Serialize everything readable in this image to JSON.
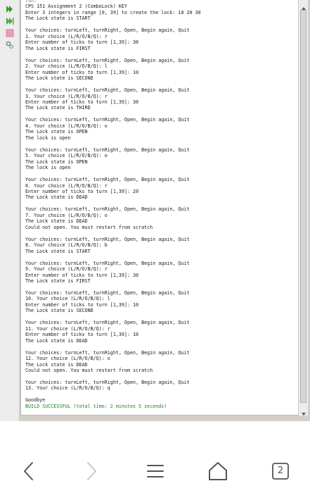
{
  "console": {
    "lines": [
      {
        "text": "run:",
        "style": "info"
      },
      {
        "text": "CPS 151 Assignment 2 (ComboLock) KEY"
      },
      {
        "text": "Enter 3 integers in range [0, 39] to create the lock: 10 20 30"
      },
      {
        "text": "The Lock state is START"
      },
      {
        "text": ""
      },
      {
        "text": "Your choices: turnLeft, turnRight, Open, Begin again, Quit"
      },
      {
        "text": "1. Your choice (L/R/O/B/Q): r"
      },
      {
        "text": "Enter number of ticks to turn [1,39]: 30"
      },
      {
        "text": "The Lock state is FIRST"
      },
      {
        "text": ""
      },
      {
        "text": "Your choices: turnLeft, turnRight, Open, Begin again, Quit"
      },
      {
        "text": "2. Your choice (L/R/O/B/Q): l"
      },
      {
        "text": "Enter number of ticks to turn [1,39]: 10"
      },
      {
        "text": "The Lock state is SECOND"
      },
      {
        "text": ""
      },
      {
        "text": "Your choices: turnLeft, turnRight, Open, Begin again, Quit"
      },
      {
        "text": "3. Your choice (L/R/O/B/Q): r"
      },
      {
        "text": "Enter number of ticks to turn [1,39]: 30"
      },
      {
        "text": "The Lock state is THIRD"
      },
      {
        "text": ""
      },
      {
        "text": "Your choices: turnLeft, turnRight, Open, Begin again, Quit"
      },
      {
        "text": "4. Your choice (L/R/O/B/Q): o"
      },
      {
        "text": "The Lock state is OPEN"
      },
      {
        "text": "The lock is open"
      },
      {
        "text": ""
      },
      {
        "text": "Your choices: turnLeft, turnRight, Open, Begin again, Quit"
      },
      {
        "text": "5. Your choice (L/R/O/B/Q): o"
      },
      {
        "text": "The Lock state is OPEN"
      },
      {
        "text": "The lock is open"
      },
      {
        "text": ""
      },
      {
        "text": "Your choices: turnLeft, turnRight, Open, Begin again, Quit"
      },
      {
        "text": "6. Your choice (L/R/O/B/Q): r"
      },
      {
        "text": "Enter number of ticks to turn [1,39]: 20"
      },
      {
        "text": "The Lock state is DEAD"
      },
      {
        "text": ""
      },
      {
        "text": "Your choices: turnLeft, turnRight, Open, Begin again, Quit"
      },
      {
        "text": "7. Your choice (L/R/O/B/Q): o"
      },
      {
        "text": "The Lock state is DEAD"
      },
      {
        "text": "Could not open. You must restart from scratch"
      },
      {
        "text": ""
      },
      {
        "text": "Your choices: turnLeft, turnRight, Open, Begin again, Quit"
      },
      {
        "text": "8. Your choice (L/R/O/B/Q): b"
      },
      {
        "text": "The Lock state is START"
      },
      {
        "text": ""
      },
      {
        "text": "Your choices: turnLeft, turnRight, Open, Begin again, Quit"
      },
      {
        "text": "9. Your choice (L/R/O/B/Q): r"
      },
      {
        "text": "Enter number of ticks to turn [1,39]: 30"
      },
      {
        "text": "The Lock state is FIRST"
      },
      {
        "text": ""
      },
      {
        "text": "Your choices: turnLeft, turnRight, Open, Begin again, Quit"
      },
      {
        "text": "10. Your choice (L/R/O/B/Q): l"
      },
      {
        "text": "Enter number of ticks to turn [1,39]: 10"
      },
      {
        "text": "The Lock state is SECOND"
      },
      {
        "text": ""
      },
      {
        "text": "Your choices: turnLeft, turnRight, Open, Begin again, Quit"
      },
      {
        "text": "11. Your choice (L/R/O/B/Q): r"
      },
      {
        "text": "Enter number of ticks to turn [1,39]: 10"
      },
      {
        "text": "The Lock state is DEAD"
      },
      {
        "text": ""
      },
      {
        "text": "Your choices: turnLeft, turnRight, Open, Begin again, Quit"
      },
      {
        "text": "12. Your choice (L/R/O/B/Q): o"
      },
      {
        "text": "The Lock state is DEAD"
      },
      {
        "text": "Could not open. You must restart from scratch"
      },
      {
        "text": ""
      },
      {
        "text": "Your choices: turnLeft, turnRight, Open, Begin again, Quit"
      },
      {
        "text": "13. Your choice (L/R/O/B/Q): q"
      },
      {
        "text": ""
      },
      {
        "text": "Goodbye"
      },
      {
        "text": "BUILD SUCCESSFUL (total time: 2 minutes 5 seconds)",
        "style": "success"
      }
    ]
  },
  "gutter": {
    "icons": [
      "run-icon",
      "rerun-icon",
      "stop-icon",
      "settings-icon"
    ]
  },
  "colors": {
    "run_green": "#3a9a2a",
    "build_success": "#1f7f1f",
    "stop_pink": "#e8a0b8"
  },
  "navbar": {
    "tabs_count": "2"
  }
}
